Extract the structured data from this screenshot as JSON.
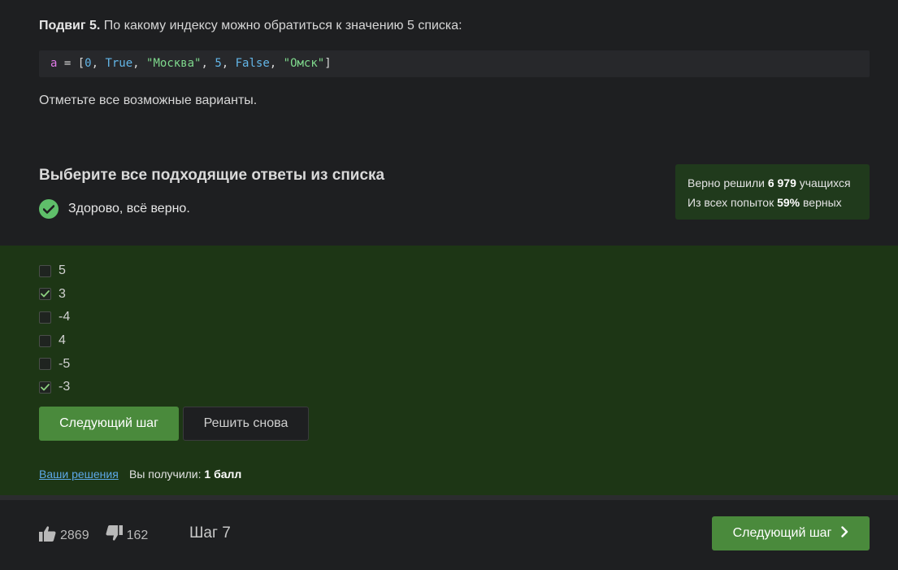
{
  "question": {
    "label": "Подвиг 5.",
    "text": " По какому индексу можно обратиться к значению 5 списка:",
    "hint": "Отметьте все возможные варианты."
  },
  "code": {
    "var": "a",
    "eq": " = [",
    "items": [
      "0",
      "True",
      "\"Москва\"",
      "5",
      "False",
      "\"Омск\""
    ],
    "close": "]"
  },
  "task": {
    "title": "Выберите все подходящие ответы из списка",
    "status": "Здорово, всё верно."
  },
  "stats": {
    "line1_prefix": "Верно решили ",
    "line1_value": "6 979",
    "line1_suffix": " учащихся",
    "line2_prefix": "Из всех попыток ",
    "line2_value": "59%",
    "line2_suffix": " верных"
  },
  "options": [
    {
      "label": "5",
      "checked": false
    },
    {
      "label": "3",
      "checked": true
    },
    {
      "label": "-4",
      "checked": false
    },
    {
      "label": "4",
      "checked": false
    },
    {
      "label": "-5",
      "checked": false
    },
    {
      "label": "-3",
      "checked": true
    }
  ],
  "buttons": {
    "next": "Следующий шаг",
    "retry": "Решить снова"
  },
  "result": {
    "solutions_link": "Ваши решения",
    "score_prefix": "Вы получили: ",
    "score_value": "1 балл"
  },
  "footer": {
    "likes": "2869",
    "dislikes": "162",
    "step": "Шаг 7",
    "next": "Следующий шаг"
  },
  "colors": {
    "accent": "#4a8a3c",
    "answers_bg": "#1d3615",
    "success": "#5fbf6a",
    "link": "#5da8e8"
  }
}
